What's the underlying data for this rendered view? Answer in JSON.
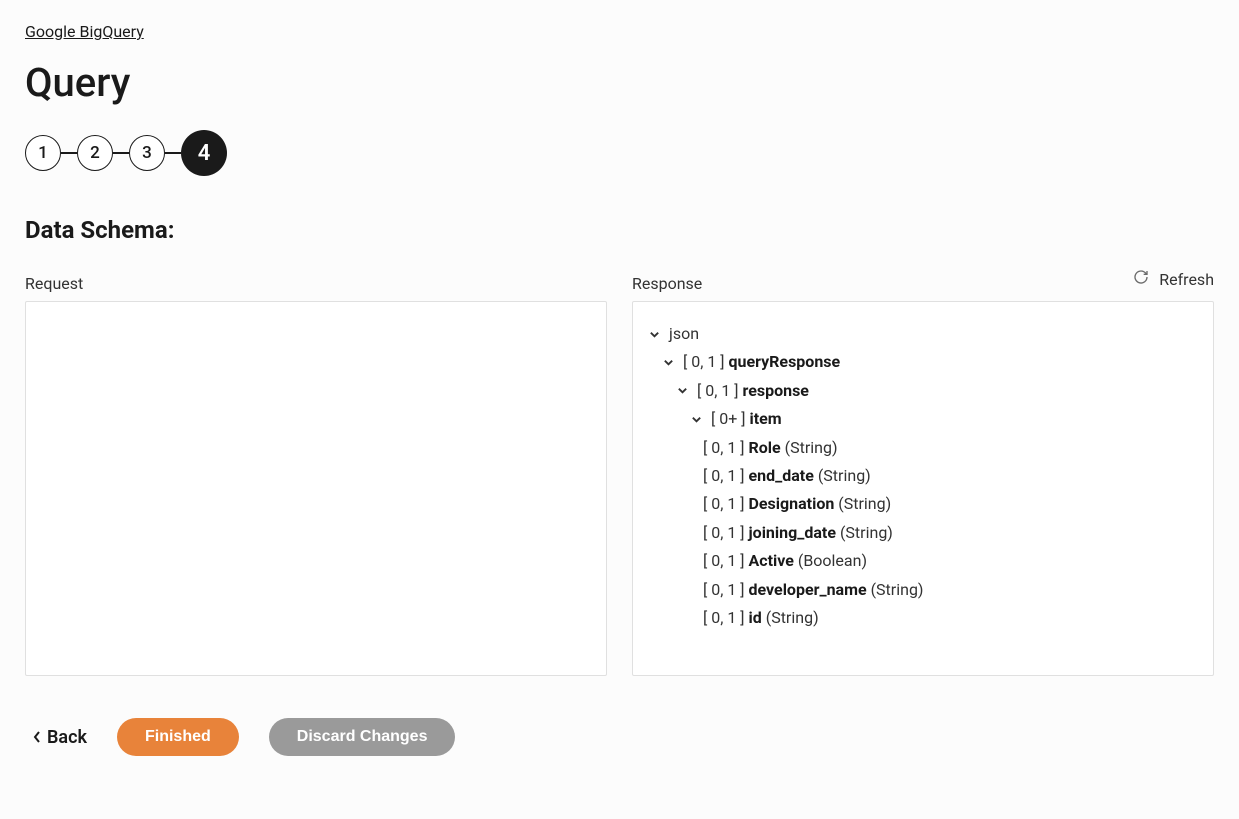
{
  "breadcrumb": "Google BigQuery",
  "pageTitle": "Query",
  "steps": [
    "1",
    "2",
    "3",
    "4"
  ],
  "activeStep": 4,
  "sectionTitle": "Data Schema:",
  "labels": {
    "request": "Request",
    "response": "Response",
    "refresh": "Refresh"
  },
  "schema": {
    "root": "json",
    "nodes": [
      {
        "card": "[ 0, 1 ]",
        "name": "queryResponse"
      },
      {
        "card": "[ 0, 1 ]",
        "name": "response"
      },
      {
        "card": "[ 0+ ]",
        "name": "item"
      }
    ],
    "fields": [
      {
        "card": "[ 0, 1 ]",
        "name": "Role",
        "type": "(String)"
      },
      {
        "card": "[ 0, 1 ]",
        "name": "end_date",
        "type": "(String)"
      },
      {
        "card": "[ 0, 1 ]",
        "name": "Designation",
        "type": "(String)"
      },
      {
        "card": "[ 0, 1 ]",
        "name": "joining_date",
        "type": "(String)"
      },
      {
        "card": "[ 0, 1 ]",
        "name": "Active",
        "type": "(Boolean)"
      },
      {
        "card": "[ 0, 1 ]",
        "name": "developer_name",
        "type": "(String)"
      },
      {
        "card": "[ 0, 1 ]",
        "name": "id",
        "type": "(String)"
      }
    ]
  },
  "buttons": {
    "back": "Back",
    "finished": "Finished",
    "discard": "Discard Changes"
  }
}
